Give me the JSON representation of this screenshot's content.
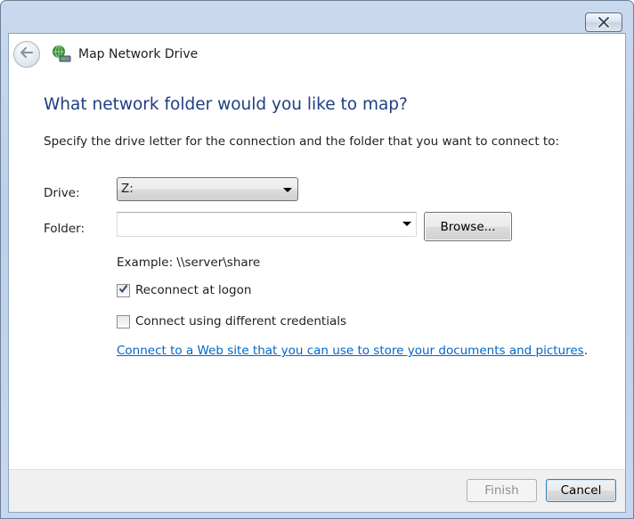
{
  "window": {
    "title": "Map Network Drive"
  },
  "main": {
    "heading": "What network folder would you like to map?",
    "instruction": "Specify the drive letter for the connection and the folder that you want to connect to:",
    "drive_label": "Drive:",
    "drive_value": "Z:",
    "folder_label": "Folder:",
    "folder_value": "",
    "browse_label": "Browse...",
    "example_text": "Example: \\\\server\\share",
    "reconnect_label": "Reconnect at logon",
    "reconnect_checked": true,
    "credentials_label": "Connect using different credentials",
    "credentials_checked": false,
    "weblink_text": "Connect to a Web site that you can use to store your documents and pictures",
    "weblink_suffix": "."
  },
  "footer": {
    "finish_label": "Finish",
    "cancel_label": "Cancel"
  },
  "icons": {
    "close": "close-icon",
    "back": "back-arrow-icon",
    "app": "network-drive-icon",
    "checkmark": "checkmark-icon",
    "dropdown": "chevron-down-icon"
  },
  "colors": {
    "heading": "#1f3d83",
    "link": "#0066cc",
    "frame": "#c9d9ee"
  }
}
